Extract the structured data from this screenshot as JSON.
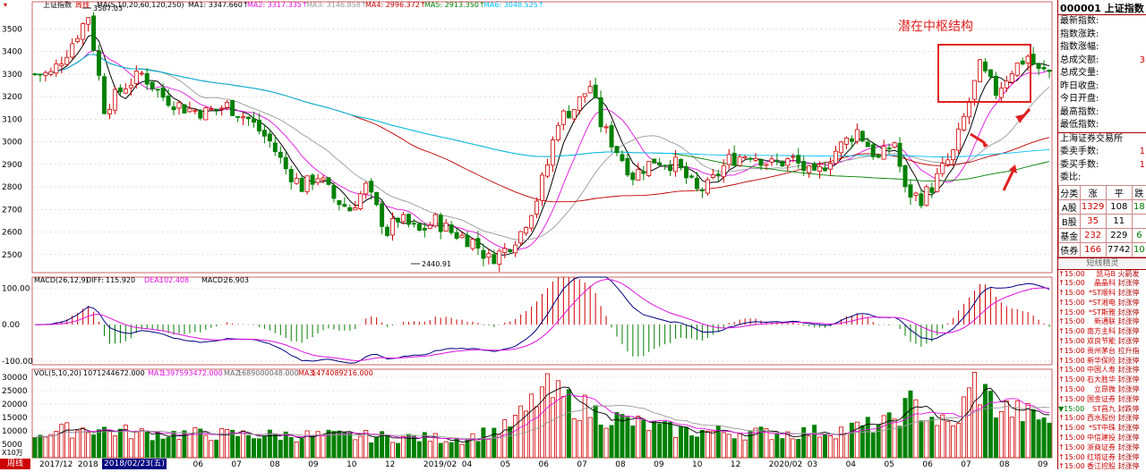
{
  "main_panel": {
    "legend_label": "上证指数",
    "legend_period": "周线",
    "ma_params": "MA(5,10,20,60,120,250)",
    "ma_values": [
      {
        "name": "MA1",
        "value": "3347.660",
        "color": "#000000"
      },
      {
        "name": "MA2",
        "value": "3317.335",
        "color": "#e010e0"
      },
      {
        "name": "MA3",
        "value": "3146.858",
        "color": "#999999"
      },
      {
        "name": "MA4",
        "value": "2996.372",
        "color": "#c00000"
      },
      {
        "name": "MA5",
        "value": "2913.350",
        "color": "#008000"
      },
      {
        "name": "MA6",
        "value": "3048.525",
        "color": "#00bfff"
      }
    ],
    "annotation": "潜在中枢结构",
    "high_label": "3587.03",
    "low_label": "2440.91"
  },
  "macd_panel": {
    "legend_params": "MACD(26,12,9)",
    "diff_label": "DIFF:",
    "diff_value": "115.920",
    "dea_label": "DEA:",
    "dea_value": "102.408",
    "macd_label": "MACD:",
    "macd_value": "26.903"
  },
  "vol_panel": {
    "legend_params": "VOL(5,10,20)",
    "vol_value": "1071244672.000",
    "ma1_label": "MA1:",
    "ma1_value": "1397593472.000",
    "ma2_label": "MA2:",
    "ma2_value": "1689000048.000",
    "ma3_label": "MA3:",
    "ma3_value": "1474089216.000",
    "unit_label": "X10万"
  },
  "bottom_axis": {
    "tab_label": "周线",
    "highlight_date": "2018/02/23(五)"
  },
  "chart_data": [
    {
      "type": "candlestick",
      "title": "上证指数 周线",
      "ylim": [
        2420,
        3620
      ],
      "yticks": [
        2500,
        2600,
        2700,
        2800,
        2900,
        3000,
        3100,
        3200,
        3300,
        3400,
        3500
      ],
      "x_tick_labels": [
        "2017/12",
        "2018",
        "",
        "05",
        "06",
        "07",
        "08",
        "09",
        "10",
        "12",
        "2019/02",
        "04",
        "05",
        "06",
        "07",
        "08",
        "09",
        "10",
        "12",
        "2020/02",
        "03",
        "04",
        "05",
        "06",
        "07",
        "08",
        "09"
      ],
      "waypoints": [
        [
          0,
          3300
        ],
        [
          3,
          3300
        ],
        [
          6,
          3400
        ],
        [
          10,
          3560
        ],
        [
          13,
          3150
        ],
        [
          17,
          3250
        ],
        [
          20,
          3300
        ],
        [
          24,
          3200
        ],
        [
          28,
          3150
        ],
        [
          32,
          3130
        ],
        [
          36,
          3160
        ],
        [
          40,
          3100
        ],
        [
          44,
          3000
        ],
        [
          47,
          2880
        ],
        [
          50,
          2800
        ],
        [
          53,
          2850
        ],
        [
          56,
          2750
        ],
        [
          59,
          2700
        ],
        [
          62,
          2800
        ],
        [
          64,
          2700
        ],
        [
          66,
          2600
        ],
        [
          68,
          2660
        ],
        [
          72,
          2600
        ],
        [
          75,
          2650
        ],
        [
          78,
          2600
        ],
        [
          82,
          2560
        ],
        [
          85,
          2480
        ],
        [
          88,
          2520
        ],
        [
          91,
          2600
        ],
        [
          94,
          2750
        ],
        [
          96,
          2900
        ],
        [
          98,
          3100
        ],
        [
          101,
          3150
        ],
        [
          104,
          3250
        ],
        [
          106,
          3080
        ],
        [
          108,
          3000
        ],
        [
          112,
          2850
        ],
        [
          116,
          2920
        ],
        [
          120,
          2900
        ],
        [
          124,
          2780
        ],
        [
          126,
          2800
        ],
        [
          130,
          2920
        ],
        [
          134,
          2950
        ],
        [
          138,
          2900
        ],
        [
          142,
          2920
        ],
        [
          146,
          2840
        ],
        [
          150,
          2960
        ],
        [
          154,
          3050
        ],
        [
          158,
          2920
        ],
        [
          161,
          3000
        ],
        [
          163,
          2780
        ],
        [
          166,
          2750
        ],
        [
          168,
          2800
        ],
        [
          170,
          2880
        ],
        [
          172,
          2950
        ],
        [
          175,
          3180
        ],
        [
          177,
          3330
        ],
        [
          180,
          3220
        ],
        [
          183,
          3320
        ],
        [
          186,
          3380
        ],
        [
          188,
          3310
        ],
        [
          190,
          3310
        ]
      ],
      "ma_periods": [
        5,
        10,
        20,
        60,
        120,
        250
      ],
      "ma_colors": [
        "#000000",
        "#e010e0",
        "#999999",
        "#c00000",
        "#008000",
        "#00bfff"
      ]
    },
    {
      "type": "bar",
      "title": "MACD(26,12,9)",
      "ylim": [
        -110,
        130
      ],
      "yticks": [
        -100,
        0,
        100
      ],
      "ytick_labels": [
        "-100.00",
        "0.00",
        "100.00"
      ],
      "series_names": [
        "DIFF",
        "DEA",
        "MACD"
      ]
    },
    {
      "type": "bar",
      "title": "VOL(5,10,20)",
      "ylim": [
        0,
        33000
      ],
      "yticks": [
        5000,
        10000,
        15000,
        20000,
        25000,
        30000
      ],
      "vol_waypoints": [
        [
          0,
          9000
        ],
        [
          10,
          11000
        ],
        [
          20,
          9000
        ],
        [
          40,
          8500
        ],
        [
          60,
          8000
        ],
        [
          80,
          7000
        ],
        [
          88,
          11000
        ],
        [
          92,
          17000
        ],
        [
          95,
          25000
        ],
        [
          100,
          21000
        ],
        [
          106,
          16000
        ],
        [
          112,
          13000
        ],
        [
          120,
          10000
        ],
        [
          130,
          9500
        ],
        [
          140,
          9000
        ],
        [
          150,
          10000
        ],
        [
          160,
          13000
        ],
        [
          164,
          20000
        ],
        [
          168,
          15000
        ],
        [
          172,
          11000
        ],
        [
          176,
          28000
        ],
        [
          180,
          19000
        ],
        [
          186,
          16000
        ],
        [
          190,
          14000
        ]
      ]
    }
  ],
  "side_panel": {
    "title": "000001 上证指数",
    "rows": [
      {
        "label": "最新指数:",
        "value": ""
      },
      {
        "label": "指数涨跌:",
        "value": ""
      },
      {
        "label": "指数涨幅:",
        "value": ""
      },
      {
        "label": "总成交额:",
        "value": "3"
      },
      {
        "label": "总成交量:",
        "value": ""
      },
      {
        "label": "昨日收盘:",
        "value": ""
      },
      {
        "label": "今日开盘:",
        "value": ""
      },
      {
        "label": "最高指数:",
        "value": ""
      },
      {
        "label": "最低指数:",
        "value": ""
      }
    ],
    "exchange_label": "上海证券交易所",
    "exchange_rows": [
      {
        "label": "委卖手数:",
        "value": "1"
      },
      {
        "label": "委买手数:",
        "value": "1"
      },
      {
        "label": "委比:",
        "value": ""
      }
    ],
    "adv_headers": [
      "分类",
      "涨",
      "平",
      "跌"
    ],
    "adv_rows": [
      [
        "A股",
        "1329",
        "108",
        "18"
      ],
      [
        "B股",
        "35",
        "11",
        ""
      ],
      [
        "基金",
        "232",
        "229",
        "6"
      ],
      [
        "债券",
        "166",
        "7742",
        "10"
      ]
    ],
    "news_header": "短线精灵",
    "news": [
      {
        "time": "15:00",
        "name": "凯马B",
        "event": "火箭发",
        "down": false
      },
      {
        "time": "15:00",
        "name": "晶晶科",
        "event": "封涨停",
        "down": false
      },
      {
        "time": "15:00",
        "name": "*ST顺科",
        "event": "封涨停",
        "down": false
      },
      {
        "time": "15:00",
        "name": "*ST湘电",
        "event": "封涨停",
        "down": false
      },
      {
        "time": "15:00",
        "name": "*ST斯雅",
        "event": "封涨停",
        "down": false
      },
      {
        "time": "15:00",
        "name": "新通联",
        "event": "封涨停",
        "down": false
      },
      {
        "time": "15:00",
        "name": "南方主科",
        "event": "封涨停",
        "down": false
      },
      {
        "time": "15:00",
        "name": "双良节能",
        "event": "封涨停",
        "down": false
      },
      {
        "time": "15:00",
        "name": "贵州茅台",
        "event": "拉升指",
        "down": false
      },
      {
        "time": "15:00",
        "name": "新华保险",
        "event": "封涨停",
        "down": false
      },
      {
        "time": "15:00",
        "name": "中国人寿",
        "event": "封涨停",
        "down": false
      },
      {
        "time": "15:00",
        "name": "石大胜华",
        "event": "封涨停",
        "down": false
      },
      {
        "time": "15:00",
        "name": "立昂微",
        "event": "封涨停",
        "down": false
      },
      {
        "time": "15:00",
        "name": "国金证券",
        "event": "封涨停",
        "down": false
      },
      {
        "time": "15:00",
        "name": "ST昌九",
        "event": "封跌停",
        "down": true
      },
      {
        "time": "15:00",
        "name": "西水股份",
        "event": "封涨停",
        "down": false
      },
      {
        "time": "15:00",
        "name": "*ST中珠",
        "event": "封涨停",
        "down": false
      },
      {
        "time": "15:00",
        "name": "中信建投",
        "event": "封涨停",
        "down": false
      },
      {
        "time": "15:00",
        "name": "浙商证券",
        "event": "封涨停",
        "down": false
      },
      {
        "time": "15:00",
        "name": "红塔证券",
        "event": "封涨停",
        "down": false
      },
      {
        "time": "15:00",
        "name": "香江控股",
        "event": "封涨停",
        "down": false
      },
      {
        "time": "15:00",
        "name": "浙商证券",
        "event": "封涨停",
        "down": false
      }
    ]
  }
}
